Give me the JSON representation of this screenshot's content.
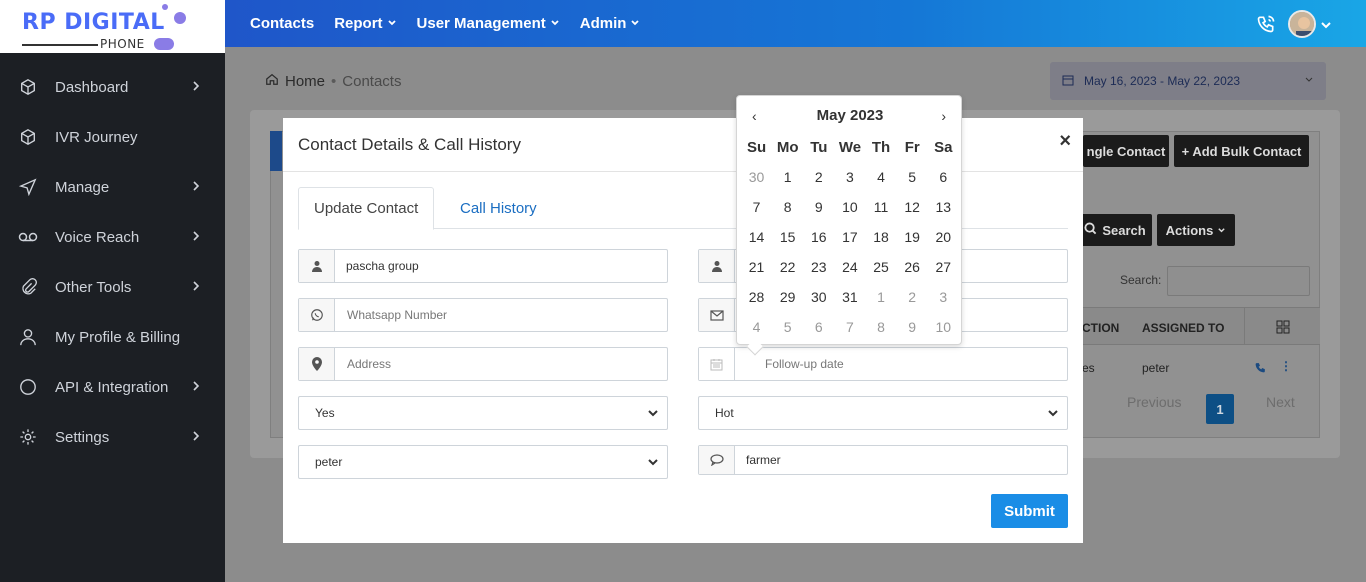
{
  "brand": {
    "name": "RP DIGITAL",
    "sub": "PHONE"
  },
  "sidebar": {
    "items": [
      {
        "label": "Dashboard",
        "icon": "cube-icon",
        "has_children": true
      },
      {
        "label": "IVR Journey",
        "icon": "cube-icon",
        "has_children": false
      },
      {
        "label": "Manage",
        "icon": "send-icon",
        "has_children": true
      },
      {
        "label": "Voice Reach",
        "icon": "voicemail-icon",
        "has_children": true
      },
      {
        "label": "Other Tools",
        "icon": "paperclip-icon",
        "has_children": true
      },
      {
        "label": "My Profile & Billing",
        "icon": "user-icon",
        "has_children": false
      },
      {
        "label": "API & Integration",
        "icon": "circle-icon",
        "has_children": true
      },
      {
        "label": "Settings",
        "icon": "gear-icon",
        "has_children": true
      }
    ]
  },
  "topnav": {
    "items": [
      {
        "label": "Contacts",
        "dropdown": false
      },
      {
        "label": "Report",
        "dropdown": true
      },
      {
        "label": "User Management",
        "dropdown": true
      },
      {
        "label": "Admin",
        "dropdown": true
      }
    ]
  },
  "breadcrumb": {
    "home": "Home",
    "current": "Contacts"
  },
  "date_range": "May 16, 2023 - May 22, 2023",
  "background_page": {
    "add_single_label": "ngle Contact",
    "add_bulk_label": "+ Add Bulk Contact",
    "search_button": "Search",
    "actions_button": "Actions",
    "search_label": "Search:",
    "columns": [
      "CTION",
      "ASSIGNED TO"
    ],
    "row": {
      "col1": "es",
      "assigned_to": "peter"
    },
    "pager": {
      "previous": "Previous",
      "page": "1",
      "next": "Next"
    }
  },
  "modal": {
    "title": "Contact Details & Call History",
    "close": "×",
    "tabs": [
      "Update Contact",
      "Call History"
    ],
    "fields": {
      "name": "pascha group",
      "whatsapp_placeholder": "Whatsapp Number",
      "address_placeholder": "Address",
      "select_left": "Yes",
      "assigned": "peter",
      "followup_placeholder": "Follow-up date",
      "select_right": "Hot",
      "note": "farmer"
    },
    "submit": "Submit"
  },
  "datepicker": {
    "title": "May 2023",
    "prev": "‹",
    "next": "›",
    "weekdays": [
      "Su",
      "Mo",
      "Tu",
      "We",
      "Th",
      "Fr",
      "Sa"
    ],
    "weeks": [
      [
        {
          "d": "30",
          "m": true
        },
        {
          "d": "1"
        },
        {
          "d": "2"
        },
        {
          "d": "3"
        },
        {
          "d": "4"
        },
        {
          "d": "5"
        },
        {
          "d": "6"
        }
      ],
      [
        {
          "d": "7"
        },
        {
          "d": "8"
        },
        {
          "d": "9"
        },
        {
          "d": "10"
        },
        {
          "d": "11"
        },
        {
          "d": "12"
        },
        {
          "d": "13"
        }
      ],
      [
        {
          "d": "14"
        },
        {
          "d": "15"
        },
        {
          "d": "16"
        },
        {
          "d": "17"
        },
        {
          "d": "18"
        },
        {
          "d": "19"
        },
        {
          "d": "20"
        }
      ],
      [
        {
          "d": "21"
        },
        {
          "d": "22"
        },
        {
          "d": "23"
        },
        {
          "d": "24"
        },
        {
          "d": "25"
        },
        {
          "d": "26"
        },
        {
          "d": "27"
        }
      ],
      [
        {
          "d": "28"
        },
        {
          "d": "29"
        },
        {
          "d": "30"
        },
        {
          "d": "31"
        },
        {
          "d": "1",
          "m": true
        },
        {
          "d": "2",
          "m": true
        },
        {
          "d": "3",
          "m": true
        }
      ],
      [
        {
          "d": "4",
          "m": true
        },
        {
          "d": "5",
          "m": true
        },
        {
          "d": "6",
          "m": true
        },
        {
          "d": "7",
          "m": true
        },
        {
          "d": "8",
          "m": true
        },
        {
          "d": "9",
          "m": true
        },
        {
          "d": "10",
          "m": true
        }
      ]
    ]
  },
  "colors": {
    "primary": "#1a8de6",
    "sidebar": "#1c1f24",
    "topbar": "#1f56c9",
    "link": "#1b6ec2"
  }
}
